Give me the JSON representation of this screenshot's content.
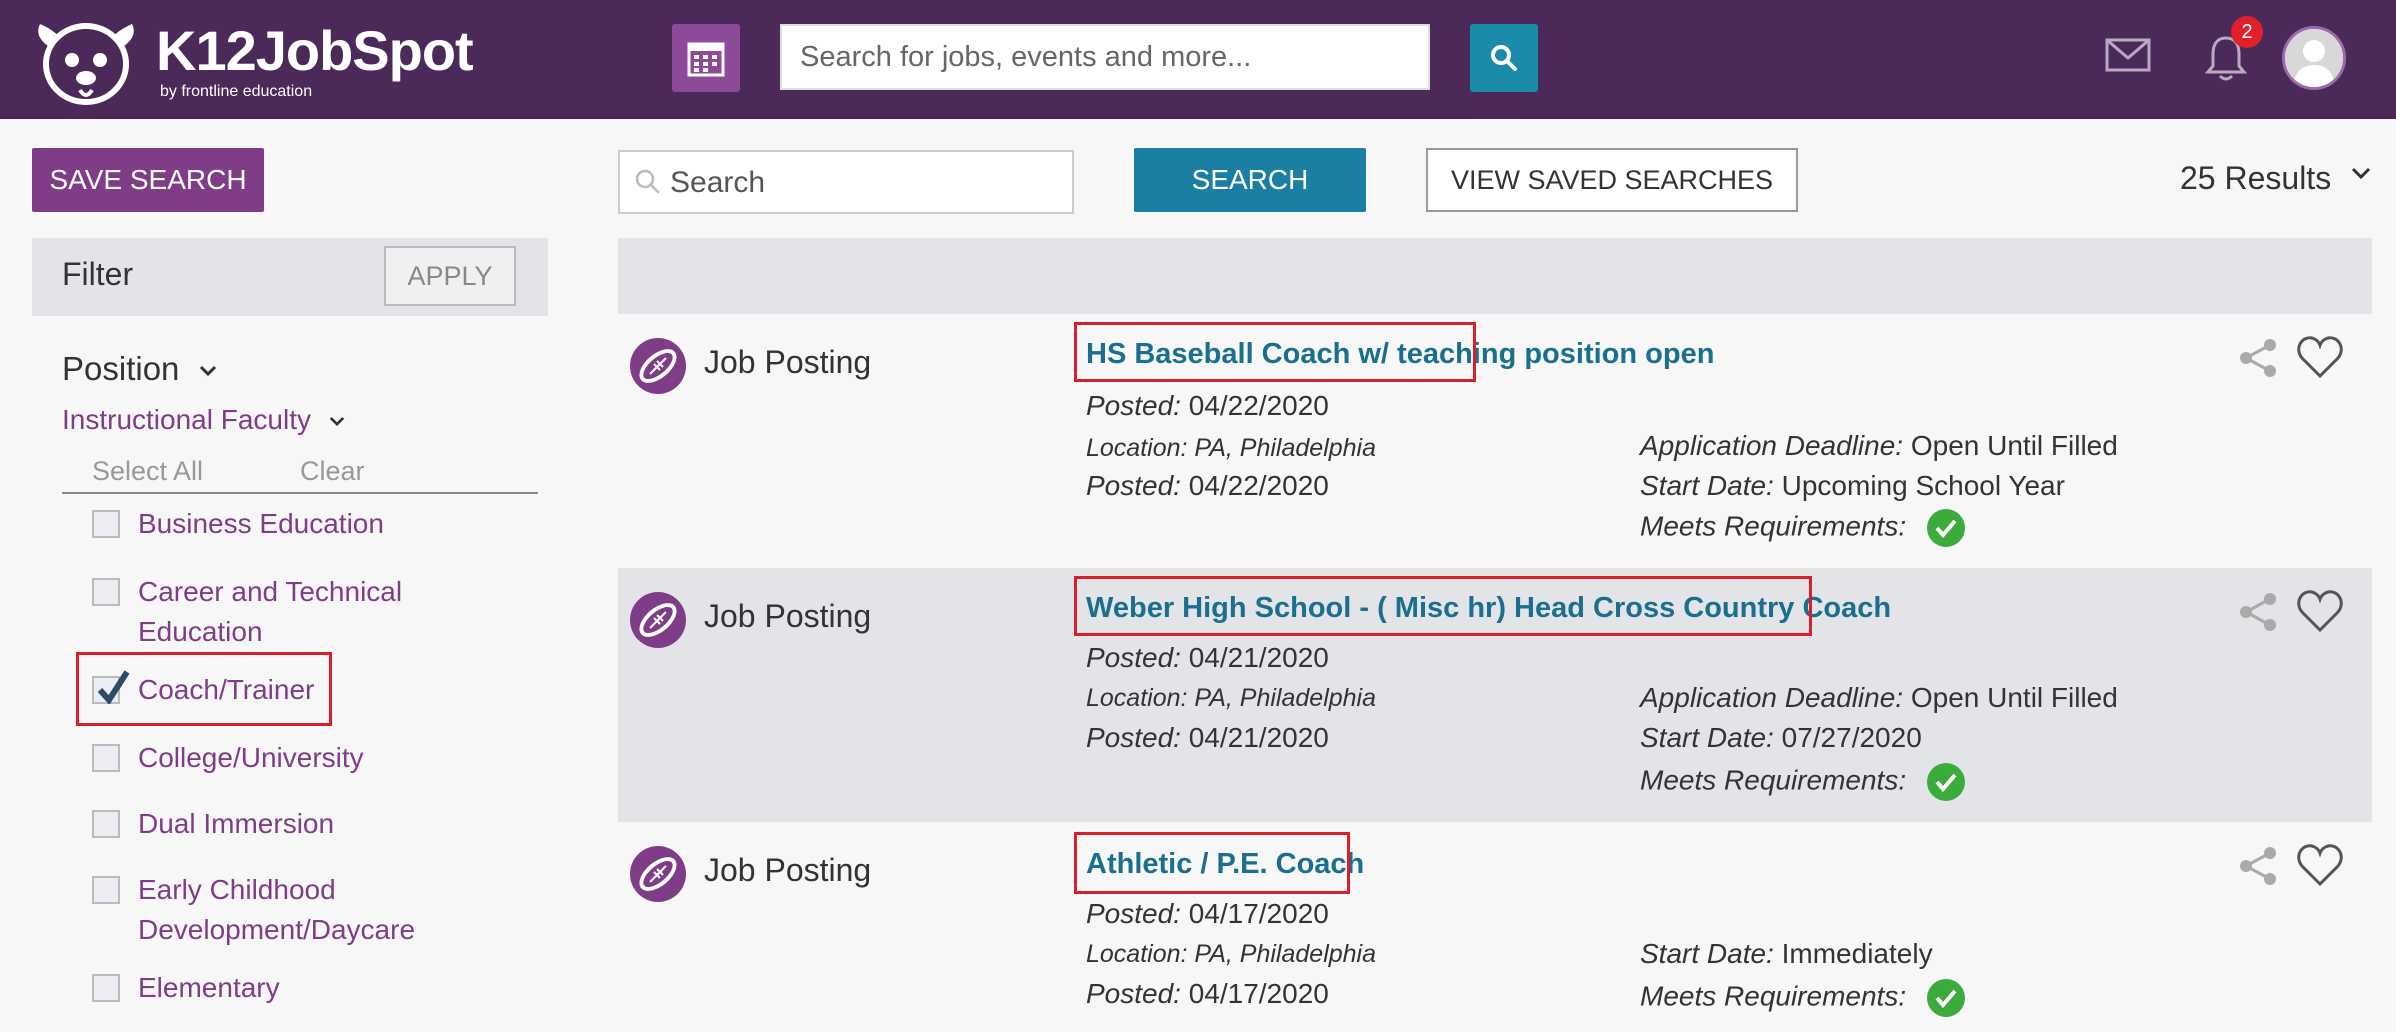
{
  "header": {
    "brand": "K12JobSpot",
    "brand_sub": "by frontline education",
    "search_placeholder": "Search for jobs, events and more...",
    "notification_count": "2"
  },
  "sidebar": {
    "save_search_label": "SAVE SEARCH",
    "filter_title": "Filter",
    "apply_label": "APPLY",
    "position_label": "Position",
    "category_label": "Instructional Faculty",
    "select_all_label": "Select All",
    "clear_label": "Clear",
    "items": [
      {
        "label": "Business Education",
        "checked": false
      },
      {
        "label": "Career and Technical Education",
        "checked": false
      },
      {
        "label": "Coach/Trainer",
        "checked": true
      },
      {
        "label": "College/University",
        "checked": false
      },
      {
        "label": "Dual Immersion",
        "checked": false
      },
      {
        "label": "Early Childhood Development/Daycare",
        "checked": false
      },
      {
        "label": "Elementary",
        "checked": false
      }
    ]
  },
  "results": {
    "search_placeholder": "Search",
    "search_button": "SEARCH",
    "saved_searches_button": "VIEW SAVED SEARCHES",
    "count_label": "25 Results",
    "jobs": [
      {
        "type": "Job Posting",
        "title": "HS Baseball Coach w/ teaching position open",
        "posted_label": "Posted:",
        "posted": "04/22/2020",
        "location": "Location: PA, Philadelphia",
        "posted2": "04/22/2020",
        "deadline_label": "Application Deadline:",
        "deadline": "Open Until Filled",
        "start_label": "Start Date:",
        "start": "Upcoming School Year",
        "meets_label": "Meets Requirements:"
      },
      {
        "type": "Job Posting",
        "title": "Weber High School - ( Misc hr) Head Cross Country Coach",
        "posted_label": "Posted:",
        "posted": "04/21/2020",
        "location": "Location: PA, Philadelphia",
        "posted2": "04/21/2020",
        "deadline_label": "Application Deadline:",
        "deadline": "Open Until Filled",
        "start_label": "Start Date:",
        "start": "07/27/2020",
        "meets_label": "Meets Requirements:"
      },
      {
        "type": "Job Posting",
        "title": "Athletic / P.E. Coach",
        "posted_label": "Posted:",
        "posted": "04/17/2020",
        "location": "Location: PA, Philadelphia",
        "posted2": "04/17/2020",
        "start_label": "Start Date:",
        "start": "Immediately",
        "meets_label": "Meets Requirements:"
      }
    ]
  },
  "colors": {
    "header_bg": "#4b2a5a",
    "accent_purple": "#7e3d86",
    "accent_teal": "#1b7fa3",
    "link_teal": "#1a6f8f",
    "highlight_red": "#d9202a",
    "success_green": "#3bab3c"
  }
}
